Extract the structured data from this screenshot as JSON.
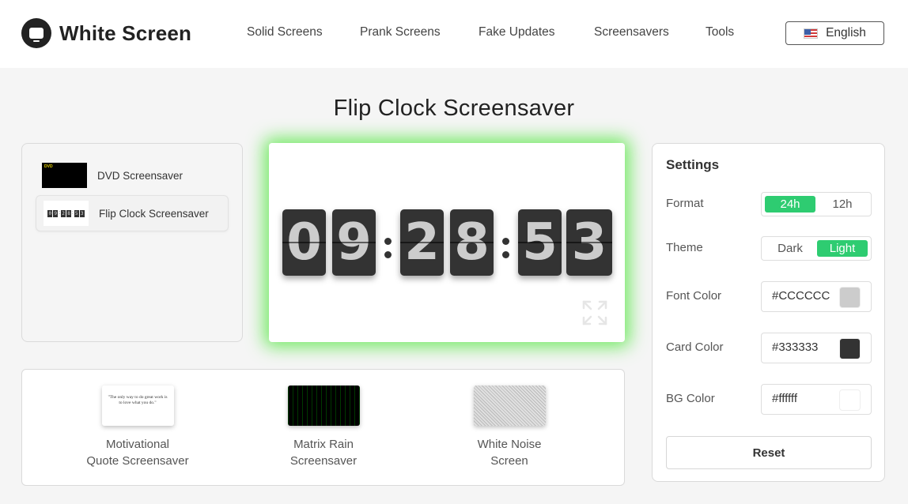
{
  "header": {
    "brand": "White Screen",
    "nav": [
      "Solid Screens",
      "Prank Screens",
      "Fake Updates",
      "Screensavers",
      "Tools"
    ],
    "language": "English"
  },
  "page_title": "Flip Clock Screensaver",
  "sidebar": {
    "items": [
      {
        "label": "DVD Screensaver",
        "active": false
      },
      {
        "label": "Flip Clock Screensaver",
        "active": true
      }
    ]
  },
  "clock": {
    "digits": [
      "0",
      "9",
      "2",
      "8",
      "5",
      "3"
    ],
    "separator": ":",
    "font_color": "#CCCCCC",
    "card_color": "#333333",
    "glow_color": "#46e632"
  },
  "recommendations": [
    {
      "line1": "Motivational",
      "line2": "Quote Screensaver",
      "thumb_text": "\"The only way to do great work is to love what you do.\""
    },
    {
      "line1": "Matrix Rain",
      "line2": "Screensaver"
    },
    {
      "line1": "White Noise",
      "line2": "Screen"
    }
  ],
  "settings": {
    "title": "Settings",
    "format": {
      "label": "Format",
      "options": [
        "24h",
        "12h"
      ],
      "selected": "24h"
    },
    "theme": {
      "label": "Theme",
      "options": [
        "Dark",
        "Light"
      ],
      "selected": "Light"
    },
    "font_color": {
      "label": "Font Color",
      "value": "#CCCCCC"
    },
    "card_color": {
      "label": "Card Color",
      "value": "#333333"
    },
    "bg_color": {
      "label": "BG Color",
      "value": "#ffffff"
    },
    "reset_label": "Reset",
    "accent": "#2ecc71"
  }
}
